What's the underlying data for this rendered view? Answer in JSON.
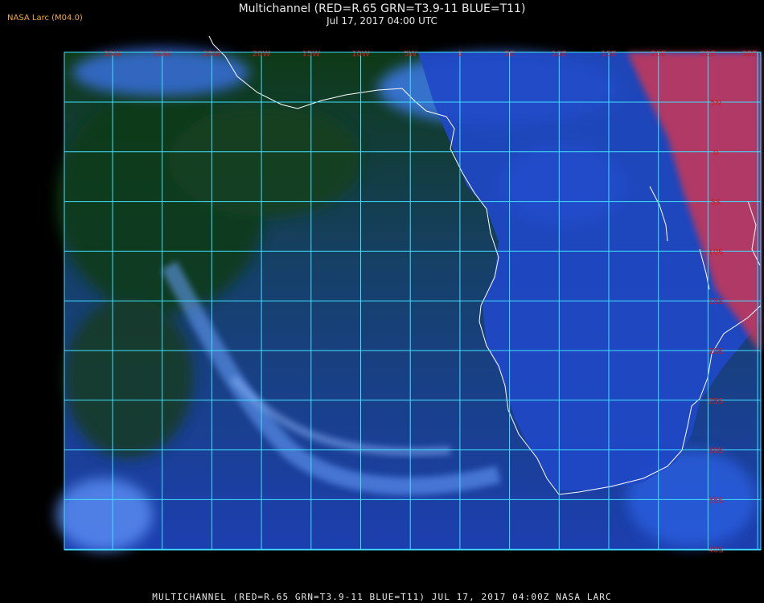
{
  "header": {
    "org_label": "NASA Larc (M04.0)",
    "title": "Multichannel (RED=R.65 GRN=T3.9-11 BLUE=T11)",
    "datetime": "Jul 17, 2017 04:00 UTC"
  },
  "footer": {
    "caption": "MULTICHANNEL  (RED=R.65 GRN=T3.9-11 BLUE=T11) JUL 17, 2017 04:00Z   NASA LARC"
  },
  "map": {
    "lon_labels": [
      "35W",
      "30W",
      "25W",
      "20W",
      "15W",
      "10W",
      "5W",
      "0",
      "5E",
      "10E",
      "15E",
      "20E",
      "25E",
      "30E",
      "35E"
    ],
    "lat_labels": [
      "5N",
      "0",
      "5S",
      "10S",
      "15S",
      "20S",
      "25S",
      "30S",
      "35S",
      "40S"
    ],
    "colors": {
      "background": "#000000",
      "ocean": "#1c3fb0",
      "land_dark": "#0f3a16",
      "cloud": "#4f86f2",
      "land_hot": "#c0385c",
      "grid": "#3fe0ff",
      "grid_label": "#d11b1b",
      "coast": "#ffffff"
    }
  }
}
